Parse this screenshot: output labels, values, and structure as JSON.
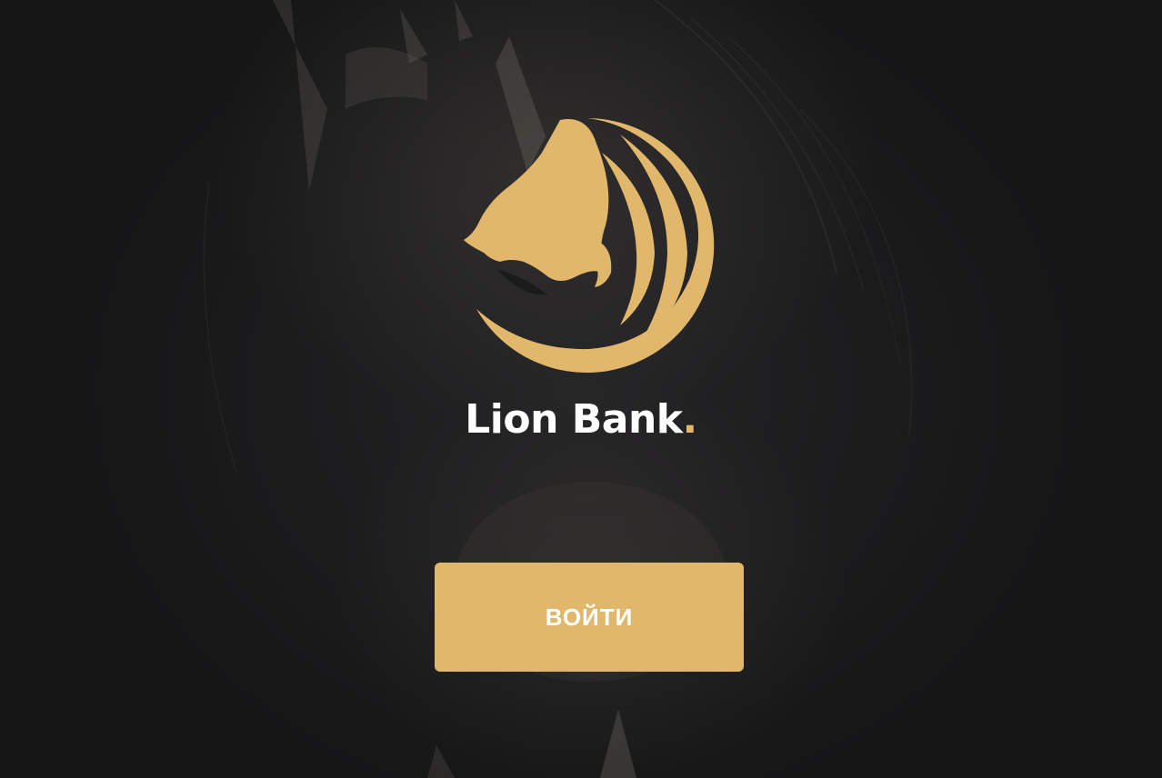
{
  "brand": {
    "name": "Lion Bank",
    "dot": "."
  },
  "logo": {
    "icon": "lion-head-crest-icon",
    "color": "#e1b76b"
  },
  "background": {
    "icon": "roaring-lion-photo",
    "base_color": "#1b1b1c"
  },
  "login": {
    "label": "ВОЙТИ",
    "color": "#e1b76b",
    "text_color": "#ffffff"
  }
}
